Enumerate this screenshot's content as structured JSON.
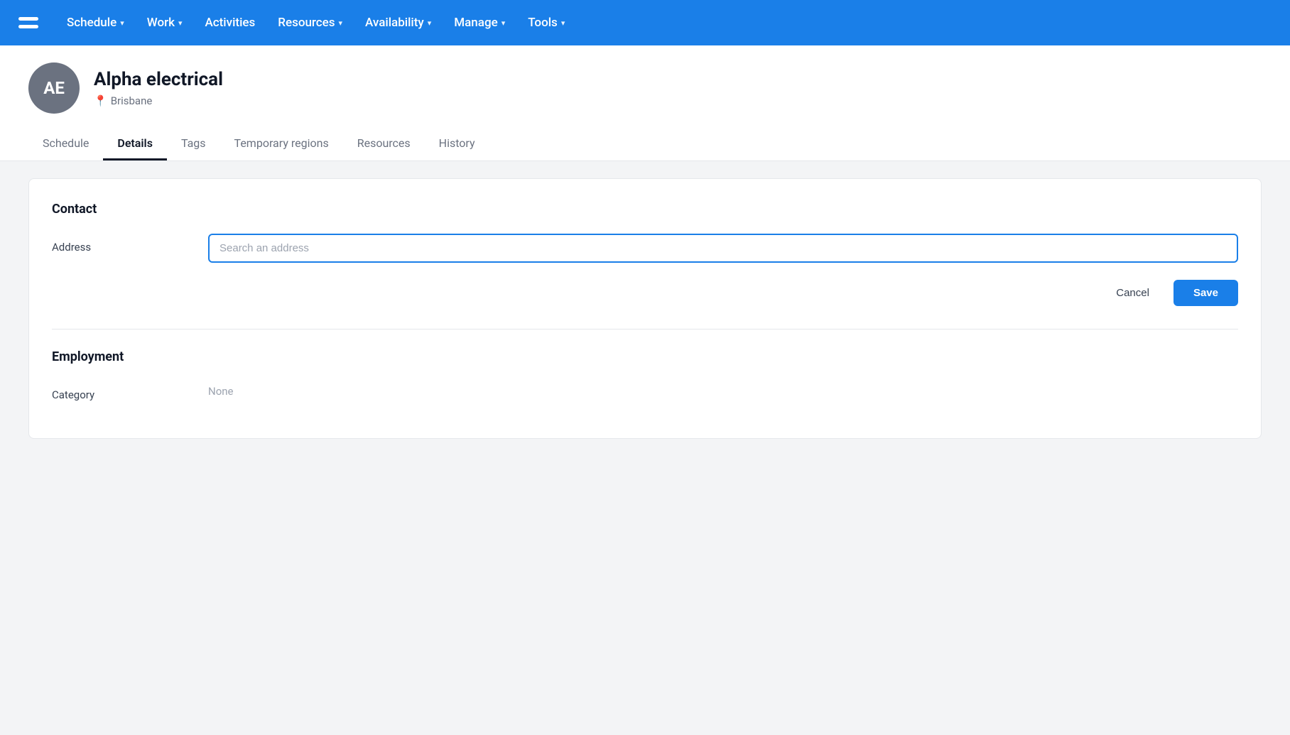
{
  "brand": {
    "logo_initials": "≡",
    "accent_color": "#1a7fe8"
  },
  "topnav": {
    "items": [
      {
        "label": "Schedule",
        "has_dropdown": true
      },
      {
        "label": "Work",
        "has_dropdown": true
      },
      {
        "label": "Activities",
        "has_dropdown": false
      },
      {
        "label": "Resources",
        "has_dropdown": true
      },
      {
        "label": "Availability",
        "has_dropdown": true
      },
      {
        "label": "Manage",
        "has_dropdown": true
      },
      {
        "label": "Tools",
        "has_dropdown": true
      }
    ]
  },
  "profile": {
    "initials": "AE",
    "name": "Alpha electrical",
    "location": "Brisbane"
  },
  "tabs": [
    {
      "label": "Schedule",
      "active": false
    },
    {
      "label": "Details",
      "active": true
    },
    {
      "label": "Tags",
      "active": false
    },
    {
      "label": "Temporary regions",
      "active": false
    },
    {
      "label": "Resources",
      "active": false
    },
    {
      "label": "History",
      "active": false
    }
  ],
  "contact_section": {
    "title": "Contact",
    "address_label": "Address",
    "address_placeholder": "Search an address"
  },
  "actions": {
    "cancel_label": "Cancel",
    "save_label": "Save"
  },
  "employment_section": {
    "title": "Employment",
    "category_label": "Category",
    "category_value": "None"
  }
}
